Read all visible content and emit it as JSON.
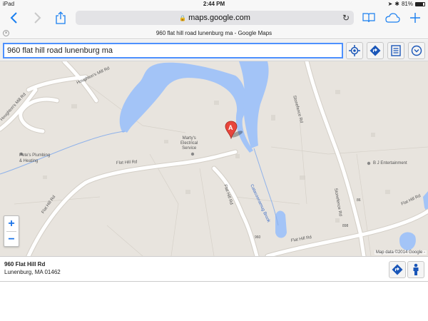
{
  "status_bar": {
    "device": "iPad",
    "time": "2:44 PM",
    "battery": "81%",
    "battery_level": 0.81
  },
  "toolbar": {
    "url": "maps.google.com",
    "icons": [
      "back-chevron",
      "forward-chevron",
      "share",
      "bookmarks",
      "icloud-tabs",
      "new-tab"
    ]
  },
  "tab": {
    "title": "960 flat hill road lunenburg ma - Google Maps"
  },
  "search": {
    "value": "960 flat hill road lunenburg ma",
    "tools": [
      "my-location",
      "directions",
      "list",
      "more"
    ]
  },
  "map": {
    "marker_label": "A",
    "labels": {
      "houghtons_mill_rd_1": "Houghton's Mill Rd",
      "houghtons_mill_rd_2": "Houghton's Mill Rd",
      "stonefence_rd_1": "Stonefence Rd",
      "stonefence_rd_2": "Stonefence Rd",
      "petes": "Pete's Plumbing\n& Heating",
      "martys": "Marty's\nElectrical\nService",
      "flat_hill_rd_1": "Flat Hill Rd",
      "flat_hill_rd_2": "Flat Hill Rd",
      "flat_hill_rd_3": "Flat Hill Rd",
      "flat_hill_rd_4": "Flat Hill Rd",
      "flat_hill_rd_5": "Flat Hill Rd",
      "gatecomb": "Catacoonamug Brook",
      "bj": "B J Entertainment",
      "num_898": "898",
      "num_960": "960",
      "num_86": "86"
    },
    "zoom_in": "+",
    "zoom_out": "−",
    "attribution": "Map data ©2014 Google -"
  },
  "info_panel": {
    "name": "960 Flat Hill Rd",
    "address": "Lunenburg, MA 01462"
  },
  "colors": {
    "accent": "#1a7ff0",
    "water": "#a3c4f7",
    "land": "#e8e4de",
    "road": "#ffffff",
    "marker": "#e8453c"
  }
}
